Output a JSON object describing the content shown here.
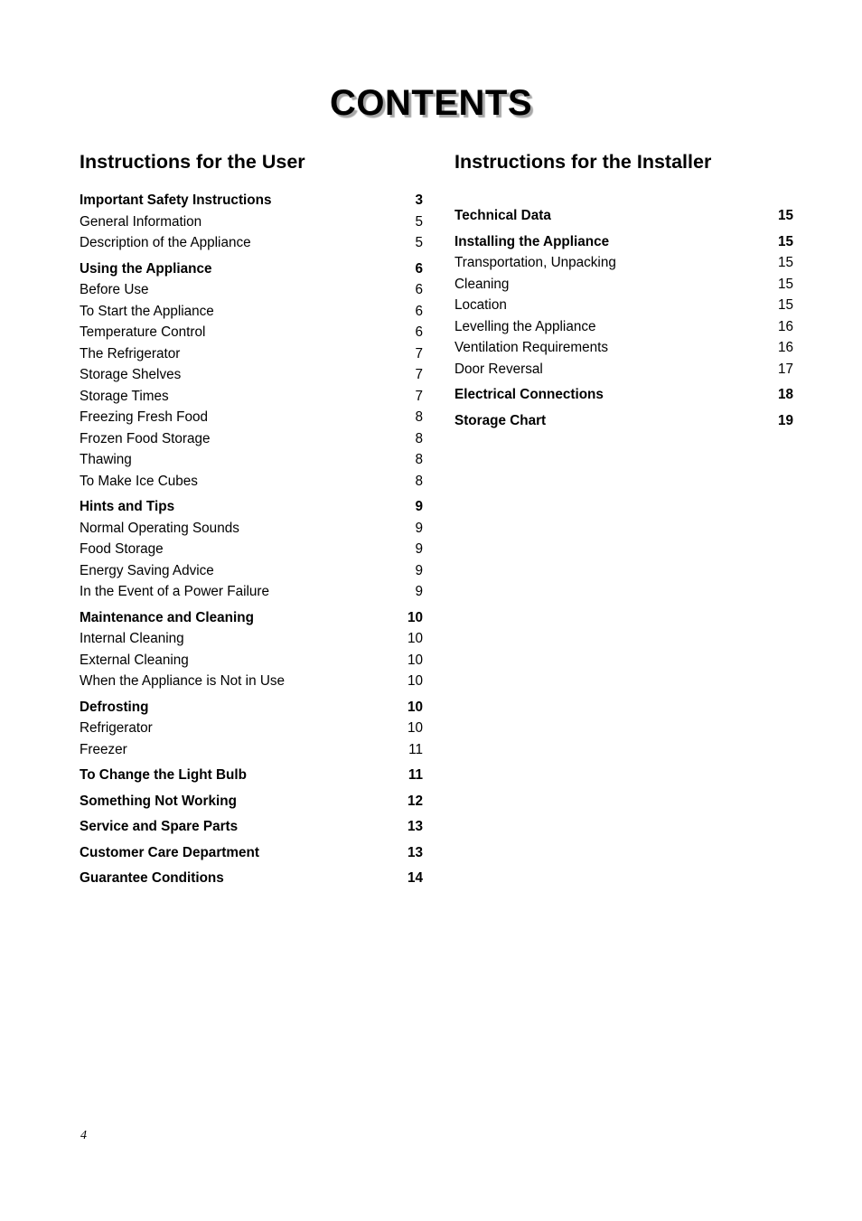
{
  "document": {
    "title": "CONTENTS",
    "folio": "4"
  },
  "columns": {
    "left": {
      "heading": "Instructions for the User",
      "entries": [
        {
          "label": "Important Safety Instructions",
          "page": "3",
          "bold": true
        },
        {
          "label": "General Information",
          "page": "5",
          "bold": false
        },
        {
          "label": "Description of the Appliance",
          "page": "5",
          "bold": false
        },
        {
          "label": "Using the Appliance",
          "page": "6",
          "bold": true
        },
        {
          "label": "Before Use",
          "page": "6",
          "bold": false
        },
        {
          "label": "To Start the Appliance",
          "page": "6",
          "bold": false
        },
        {
          "label": "Temperature Control",
          "page": "6",
          "bold": false
        },
        {
          "label": "The Refrigerator",
          "page": "7",
          "bold": false
        },
        {
          "label": "Storage Shelves",
          "page": "7",
          "bold": false
        },
        {
          "label": "Storage Times",
          "page": "7",
          "bold": false
        },
        {
          "label": "Freezing Fresh Food",
          "page": "8",
          "bold": false
        },
        {
          "label": "Frozen Food Storage",
          "page": "8",
          "bold": false
        },
        {
          "label": "Thawing",
          "page": "8",
          "bold": false
        },
        {
          "label": "To Make Ice Cubes",
          "page": "8",
          "bold": false
        },
        {
          "label": "Hints and Tips",
          "page": "9",
          "bold": true
        },
        {
          "label": "Normal Operating Sounds",
          "page": "9",
          "bold": false
        },
        {
          "label": "Food Storage",
          "page": "9",
          "bold": false
        },
        {
          "label": "Energy Saving Advice",
          "page": "9",
          "bold": false
        },
        {
          "label": "In the Event of a Power Failure",
          "page": "9",
          "bold": false
        },
        {
          "label": "Maintenance and Cleaning",
          "page": "10",
          "bold": true
        },
        {
          "label": "Internal Cleaning",
          "page": "10",
          "bold": false
        },
        {
          "label": "External Cleaning",
          "page": "10",
          "bold": false
        },
        {
          "label": "When the Appliance is Not in Use",
          "page": "10",
          "bold": false
        },
        {
          "label": "Defrosting",
          "page": "10",
          "bold": true
        },
        {
          "label": "Refrigerator",
          "page": "10",
          "bold": false
        },
        {
          "label": "Freezer",
          "page": "11",
          "bold": false
        },
        {
          "label": "To Change the Light Bulb",
          "page": "11",
          "bold": true
        },
        {
          "label": "Something Not Working",
          "page": "12",
          "bold": true
        },
        {
          "label": "Service and Spare Parts",
          "page": "13",
          "bold": true
        },
        {
          "label": "Customer Care Department",
          "page": "13",
          "bold": true
        },
        {
          "label": "Guarantee Conditions",
          "page": "14",
          "bold": true
        }
      ]
    },
    "right": {
      "heading": "Instructions for the Installer",
      "entries": [
        {
          "label": "Technical Data",
          "page": "15",
          "bold": true
        },
        {
          "label": "Installing the Appliance",
          "page": "15",
          "bold": true
        },
        {
          "label": "Transportation, Unpacking",
          "page": "15",
          "bold": false
        },
        {
          "label": "Cleaning",
          "page": "15",
          "bold": false
        },
        {
          "label": "Location",
          "page": "15",
          "bold": false
        },
        {
          "label": "Levelling the Appliance",
          "page": "16",
          "bold": false
        },
        {
          "label": "Ventilation Requirements",
          "page": "16",
          "bold": false
        },
        {
          "label": "Door Reversal",
          "page": "17",
          "bold": false
        },
        {
          "label": "Electrical Connections",
          "page": "18",
          "bold": true
        },
        {
          "label": "Storage Chart",
          "page": "19",
          "bold": true
        }
      ]
    }
  }
}
